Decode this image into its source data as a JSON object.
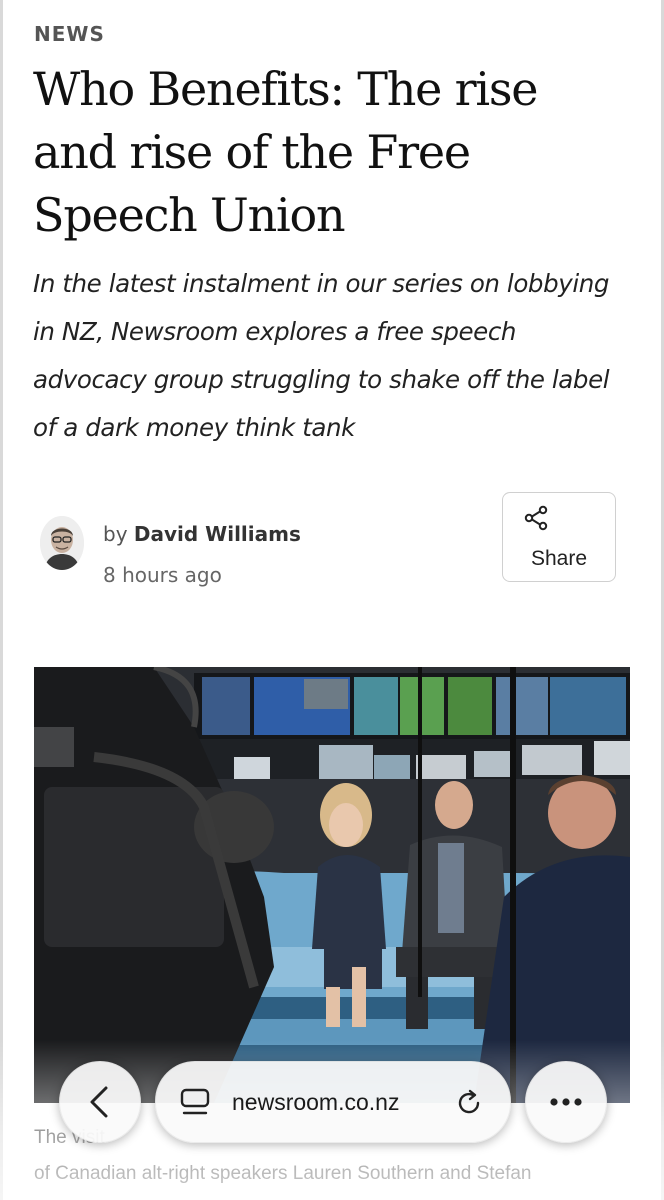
{
  "article": {
    "category": "NEWS",
    "headline": "Who Benefits: The rise and rise of the Free Speech Union",
    "standfirst": "In the latest instalment in our series on lobbying in NZ, Newsroom explores a free speech advocacy group struggling to shake off the label of a dark money think tank",
    "byline_prefix": "by",
    "author": "David Williams",
    "timestamp": "8 hours ago",
    "share_label": "Share",
    "caption_line1": "The visit",
    "caption_line2": "of Canadian alt-right speakers Lauren Southern and Stefan"
  },
  "browser": {
    "url": "newsroom.co.nz"
  },
  "icons": {
    "back": "chevron-left-icon",
    "tabs": "tabs-icon",
    "reload": "reload-icon",
    "more": "more-dots-icon",
    "share": "share-icon"
  },
  "colors": {
    "text": "#111111",
    "muted": "#666666",
    "toolbar_bg": "#fafafa",
    "studio_blue": "#6fa8cc"
  }
}
